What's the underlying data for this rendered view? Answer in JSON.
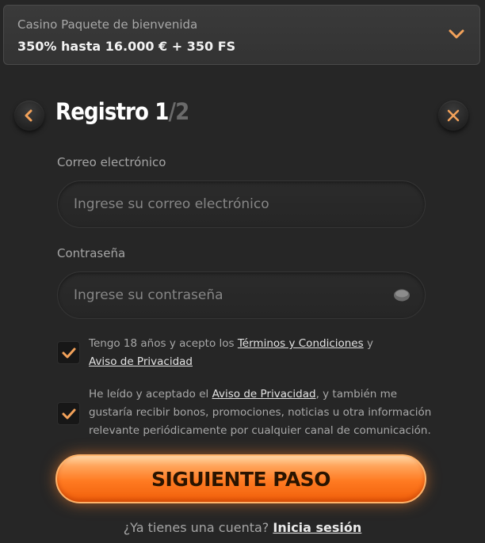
{
  "bonus": {
    "label": "Casino Paquete de bienvenida",
    "value": "350% hasta 16.000 € + 350 FS"
  },
  "header": {
    "title": "Registro 1",
    "step_total": "/2",
    "back_icon": "chevron-left-icon",
    "close_icon": "close-icon"
  },
  "form": {
    "email_label": "Correo electrónico",
    "email_placeholder": "Ingrese su correo electrónico",
    "email_value": "",
    "password_label": "Contraseña",
    "password_placeholder": "Ingrese su contraseña",
    "password_value": ""
  },
  "consents": {
    "terms_prefix": "Tengo 18 años y acepto los ",
    "terms_link": "Términos y Condiciones",
    "terms_and": " y",
    "privacy_link": "Aviso de Privacidad",
    "terms_checked": true,
    "marketing_prefix": "He leído y aceptado el ",
    "marketing_link": "Aviso de Privacidad",
    "marketing_suffix": ", y también me gustaría recibir bonos, promociones, noticias u otra información relevante periódicamente por cualquier canal de comunicación.",
    "marketing_checked": true
  },
  "cta": {
    "label": "SIGUIENTE PASO"
  },
  "login": {
    "prompt": "¿Ya tienes una cuenta? ",
    "link": "Inicia sesión"
  },
  "colors": {
    "accent": "#ff7a21",
    "icon_accent": "#f3a25a",
    "background": "#262626"
  }
}
